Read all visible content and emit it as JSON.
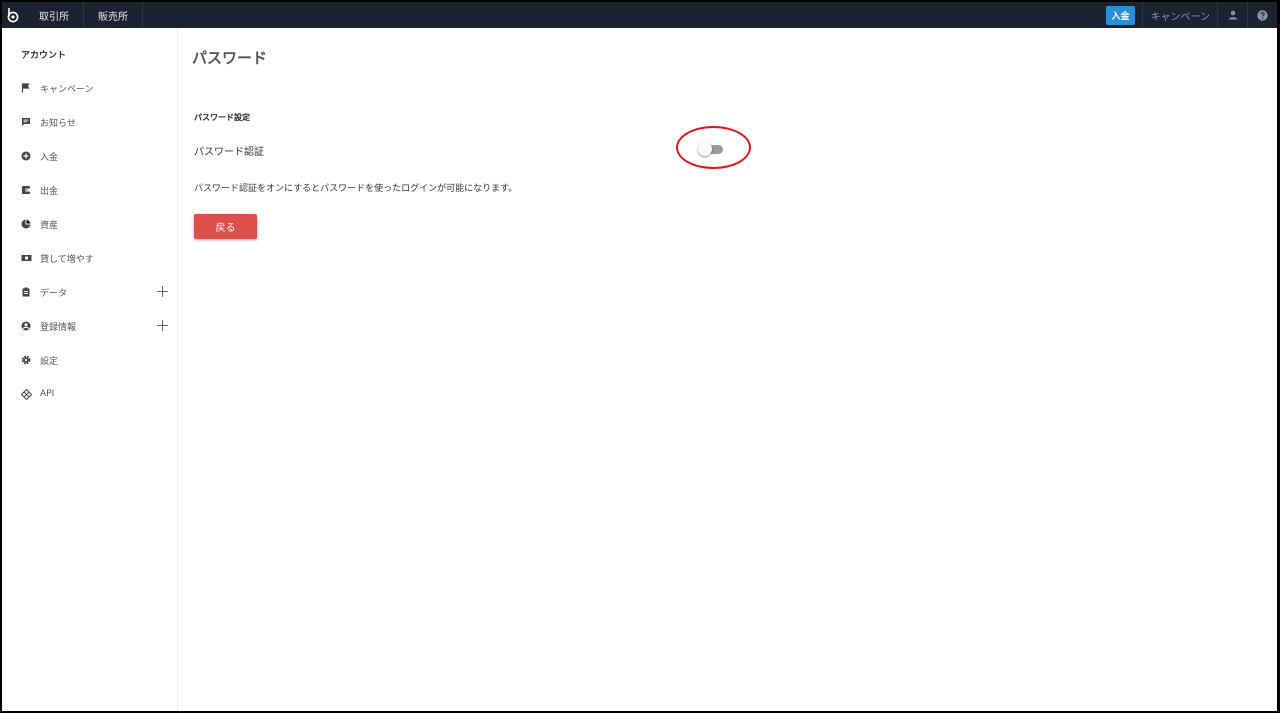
{
  "topbar": {
    "nav": [
      "取引所",
      "販売所"
    ],
    "deposit_label": "入金",
    "campaign_label": "キャンペーン",
    "icons": [
      "logo-icon",
      "user-icon",
      "help-icon"
    ]
  },
  "sidebar": {
    "title": "アカウント",
    "items": [
      {
        "label": "キャンペーン",
        "icon": "flag-icon"
      },
      {
        "label": "お知らせ",
        "icon": "message-icon"
      },
      {
        "label": "入金",
        "icon": "plus-circle-icon"
      },
      {
        "label": "出金",
        "icon": "wallet-icon"
      },
      {
        "label": "資産",
        "icon": "pie-chart-icon"
      },
      {
        "label": "貸して増やす",
        "icon": "money-icon"
      },
      {
        "label": "データ",
        "icon": "clipboard-icon",
        "expandable": true
      },
      {
        "label": "登録情報",
        "icon": "account-circle-icon",
        "expandable": true
      },
      {
        "label": "設定",
        "icon": "gear-icon"
      },
      {
        "label": "API",
        "icon": "api-icon"
      }
    ]
  },
  "main": {
    "title": "パスワード",
    "section_heading": "パスワード設定",
    "setting_label": "パスワード認証",
    "toggle_on": false,
    "description": "パスワード認証をオンにするとパスワードを使ったログインが可能になります。",
    "back_label": "戻る"
  },
  "colors": {
    "topbar_bg": "#1c2230",
    "deposit_button": "#2a8fd6",
    "back_button": "#dc4f4a",
    "highlight": "#e0161c"
  }
}
